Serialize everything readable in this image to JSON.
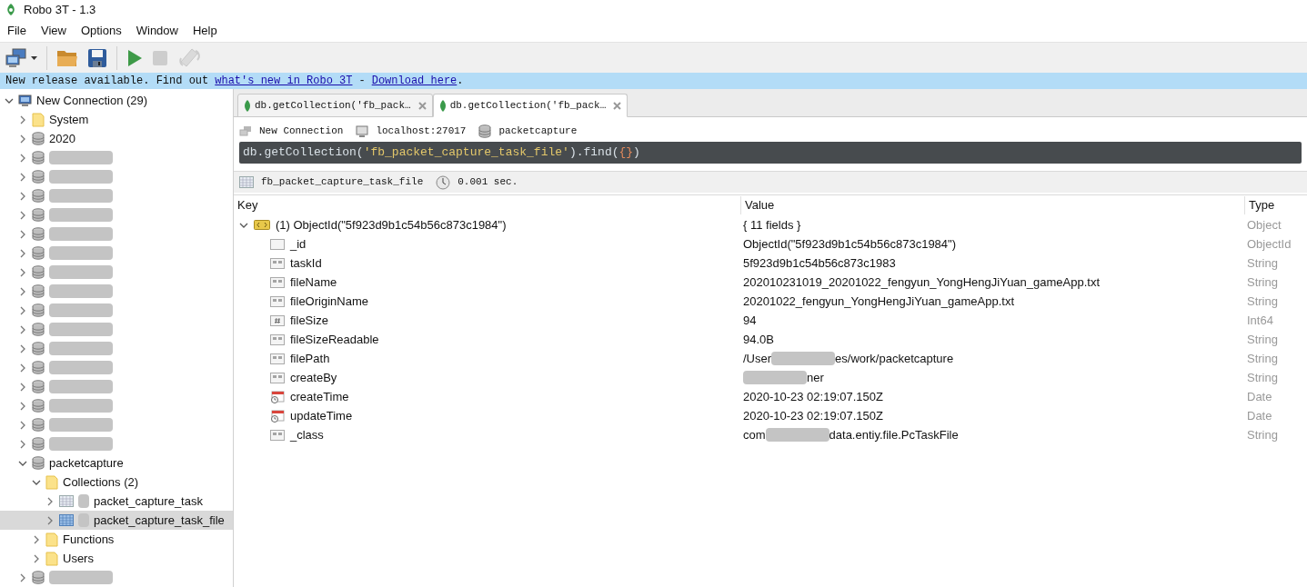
{
  "window": {
    "title": "Robo 3T - 1.3"
  },
  "menu": [
    "File",
    "View",
    "Options",
    "Window",
    "Help"
  ],
  "toolbar": [
    {
      "kind": "connect",
      "disabled": false
    },
    {
      "kind": "open",
      "disabled": false
    },
    {
      "kind": "save",
      "disabled": false
    },
    {
      "kind": "run",
      "disabled": false
    },
    {
      "kind": "stop",
      "disabled": true
    },
    {
      "kind": "rotate",
      "disabled": true
    }
  ],
  "banner": {
    "text": "New release available. Find out",
    "link_1": "what's new in Robo 3T",
    "separator": "-",
    "link_2": "Download here",
    "end": "."
  },
  "tree": [
    {
      "kind": "connection",
      "label": "New Connection (29)",
      "expanded": true,
      "selected": false,
      "children": [
        {
          "kind": "folder",
          "label": "System",
          "expanded": false,
          "selected": false
        },
        {
          "kind": "database",
          "label": "2020",
          "expanded": false,
          "selected": false
        },
        {
          "kind": "database",
          "redacted": true,
          "expanded": false,
          "selected": false
        },
        {
          "kind": "database",
          "redacted": true,
          "expanded": false,
          "selected": false
        },
        {
          "kind": "database",
          "redacted": true,
          "expanded": false,
          "selected": false
        },
        {
          "kind": "database",
          "redacted": true,
          "expanded": false,
          "selected": false
        },
        {
          "kind": "database",
          "redacted": true,
          "expanded": false,
          "selected": false
        },
        {
          "kind": "database",
          "redacted": true,
          "expanded": false,
          "selected": false
        },
        {
          "kind": "database",
          "redacted": true,
          "expanded": false,
          "selected": false
        },
        {
          "kind": "database",
          "redacted": true,
          "expanded": false,
          "selected": false
        },
        {
          "kind": "database",
          "redacted": true,
          "expanded": false,
          "selected": false
        },
        {
          "kind": "database",
          "redacted": true,
          "expanded": false,
          "selected": false
        },
        {
          "kind": "database",
          "redacted": true,
          "expanded": false,
          "selected": false
        },
        {
          "kind": "database",
          "redacted": true,
          "expanded": false,
          "selected": false
        },
        {
          "kind": "database",
          "redacted": true,
          "expanded": false,
          "selected": false
        },
        {
          "kind": "database",
          "redacted": true,
          "expanded": false,
          "selected": false
        },
        {
          "kind": "database",
          "redacted": true,
          "expanded": false,
          "selected": false
        },
        {
          "kind": "database",
          "redacted": true,
          "expanded": false,
          "selected": false
        },
        {
          "kind": "database",
          "label": "packetcapture",
          "expanded": true,
          "selected": false,
          "children": [
            {
              "kind": "folder",
              "label": "Collections (2)",
              "expanded": true,
              "selected": false,
              "children": [
                {
                  "kind": "collection",
                  "label": "packet_capture_task",
                  "redacted_prefix": true,
                  "expanded": false,
                  "selected": false
                },
                {
                  "kind": "collection",
                  "label": "packet_capture_task_file",
                  "redacted_prefix": true,
                  "expanded": false,
                  "selected": true
                }
              ]
            },
            {
              "kind": "folder",
              "label": "Functions",
              "expanded": false,
              "selected": false
            },
            {
              "kind": "folder",
              "label": "Users",
              "expanded": false,
              "selected": false
            }
          ]
        },
        {
          "kind": "database",
          "redacted": true,
          "expanded": false,
          "selected": false
        }
      ]
    }
  ],
  "tabs": [
    {
      "label": "db.getCollection('fb_pack…",
      "selected": false
    },
    {
      "label": "db.getCollection('fb_pack…",
      "selected": true
    }
  ],
  "connection_info": {
    "connection": "New Connection",
    "server": "localhost:27017",
    "database": "packetcapture"
  },
  "query": {
    "prefix": "db.getCollection(",
    "string": "'fb_packet_capture_task_file'",
    "method": ").find(",
    "braces": "{}",
    "suffix": ")"
  },
  "results_header": {
    "collection": "fb_packet_capture_task_file",
    "time": "0.001 sec."
  },
  "table": {
    "columns": [
      "Key",
      "Value",
      "Type"
    ],
    "rows": [
      {
        "kind": "document",
        "key": "(1) ObjectId(\"5f923d9b1c54b56c873c1984\")",
        "value": "{ 11 fields }",
        "type": "Object",
        "expanded": true,
        "children": [
          {
            "kind": "objectid",
            "key": "_id",
            "value": "ObjectId(\"5f923d9b1c54b56c873c1984\")",
            "type": "ObjectId"
          },
          {
            "kind": "string",
            "key": "taskId",
            "value": "5f923d9b1c54b56c873c1983",
            "type": "String"
          },
          {
            "kind": "string",
            "key": "fileName",
            "value": "202010231019_20201022_fengyun_YongHengJiYuan_gameApp.txt",
            "type": "String"
          },
          {
            "kind": "string",
            "key": "fileOriginName",
            "value": "20201022_fengyun_YongHengJiYuan_gameApp.txt",
            "type": "String"
          },
          {
            "kind": "number",
            "key": "fileSize",
            "value": "94",
            "type": "Int64"
          },
          {
            "kind": "string",
            "key": "fileSizeReadable",
            "value": "94.0B",
            "type": "String"
          },
          {
            "kind": "string",
            "key": "filePath",
            "value_segments": [
              {
                "kind": "text",
                "text": "/User"
              },
              {
                "kind": "redacted"
              },
              {
                "kind": "text",
                "text": "es/work/packetcapture"
              }
            ],
            "type": "String"
          },
          {
            "kind": "string",
            "key": "createBy",
            "value_segments": [
              {
                "kind": "redacted"
              },
              {
                "kind": "text",
                "text": "ner"
              }
            ],
            "type": "String"
          },
          {
            "kind": "date",
            "key": "createTime",
            "value": "2020-10-23 02:19:07.150Z",
            "type": "Date"
          },
          {
            "kind": "date",
            "key": "updateTime",
            "value": "2020-10-23 02:19:07.150Z",
            "type": "Date"
          },
          {
            "kind": "string",
            "key": "_class",
            "value_segments": [
              {
                "kind": "text",
                "text": "com"
              },
              {
                "kind": "redacted"
              },
              {
                "kind": "text",
                "text": "data.entiy.file.PcTaskFile"
              }
            ],
            "type": "String"
          }
        ]
      }
    ]
  }
}
